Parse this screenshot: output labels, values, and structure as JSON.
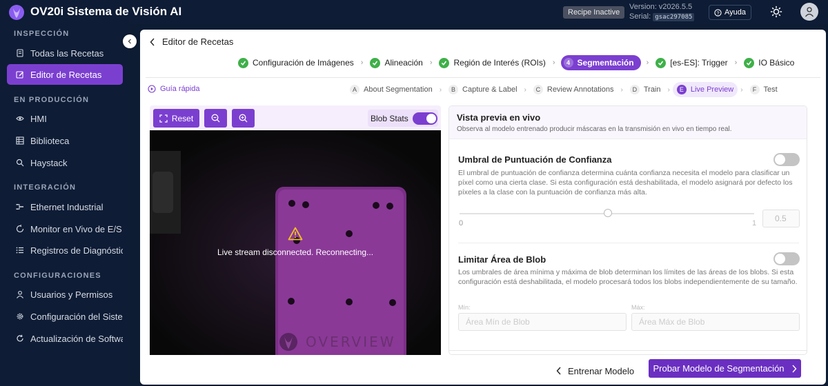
{
  "header": {
    "title": "OV20i Sistema de Visión AI",
    "recipe_badge": "Recipe Inactive",
    "version": "Version: v2026.5.5",
    "serial_label": "Serial:",
    "serial_value": "gsac297085",
    "help_label": "Ayuda"
  },
  "sidebar": {
    "sections": [
      {
        "title": "INSPECCIÓN",
        "items": [
          {
            "label": "Todas las Recetas",
            "icon": "document-icon"
          },
          {
            "label": "Editor de Recetas",
            "icon": "edit-icon",
            "active": true
          }
        ]
      },
      {
        "title": "EN PRODUCCIÓN",
        "items": [
          {
            "label": "HMI",
            "icon": "eye-icon"
          },
          {
            "label": "Biblioteca",
            "icon": "grid-icon"
          },
          {
            "label": "Haystack",
            "icon": "search-icon"
          }
        ]
      },
      {
        "title": "INTEGRACIÓN",
        "items": [
          {
            "label": "Ethernet Industrial",
            "icon": "network-icon"
          },
          {
            "label": "Monitor en Vivo de E/S",
            "icon": "monitor-icon"
          },
          {
            "label": "Registros de Diagnóstico",
            "icon": "log-icon"
          }
        ]
      },
      {
        "title": "CONFIGURACIONES",
        "items": [
          {
            "label": "Usuarios y Permisos",
            "icon": "user-icon"
          },
          {
            "label": "Configuración del Sistema",
            "icon": "gear-icon"
          },
          {
            "label": "Actualización de Software",
            "icon": "refresh-icon"
          }
        ]
      }
    ]
  },
  "page": {
    "back_label": "Editor de Recetas",
    "steps": [
      {
        "label": "Configuración de Imágenes",
        "state": "done"
      },
      {
        "label": "Alineación",
        "state": "done"
      },
      {
        "label": "Región de Interés (ROIs)",
        "state": "done"
      },
      {
        "label": "Segmentación",
        "state": "current",
        "number": "4"
      },
      {
        "label": "[es-ES]: Trigger",
        "state": "done"
      },
      {
        "label": "IO Básico",
        "state": "done"
      }
    ],
    "quick_guide": "Guía rápida",
    "substeps": [
      {
        "letter": "A",
        "label": "About Segmentation"
      },
      {
        "letter": "B",
        "label": "Capture & Label"
      },
      {
        "letter": "C",
        "label": "Review Annotations"
      },
      {
        "letter": "D",
        "label": "Train"
      },
      {
        "letter": "E",
        "label": "Live Preview",
        "current": true
      },
      {
        "letter": "F",
        "label": "Test"
      }
    ]
  },
  "viewer": {
    "reset_label": "Reset",
    "blob_stats_label": "Blob Stats",
    "blob_stats_on": true,
    "stream_message": "Live stream disconnected. Reconnecting...",
    "watermark": "OVERVIEW"
  },
  "panel": {
    "title": "Vista previa en vivo",
    "subtitle": "Observa al modelo entrenado producir máscaras en la transmisión en vivo en tiempo real.",
    "confidence": {
      "title": "Umbral de Puntuación de Confianza",
      "description": "El umbral de puntuación de confianza determina cuánta confianza necesita el modelo para clasificar un píxel como una cierta clase. Si esta configuración está deshabilitada, el modelo asignará por defecto los píxeles a la clase con la puntuación de confianza más alta.",
      "enabled": false,
      "min": "0",
      "max": "1",
      "value": "0.5",
      "slider_fraction": 0.5
    },
    "blob_area": {
      "title": "Limitar Área de Blob",
      "description": "Los umbrales de área mínima y máxima de blob determinan los límites de las áreas de los blobs. Si esta configuración está deshabilitada, el modelo procesará todos los blobs independientemente de su tamaño.",
      "enabled": false,
      "min_label": "Mín:",
      "max_label": "Máx:",
      "min_placeholder": "Área Mín de Blob",
      "max_placeholder": "Área Máx de Blob"
    }
  },
  "footer": {
    "back_label": "Entrenar Modelo",
    "primary_label": "Probar Modelo de Segmentación"
  },
  "colors": {
    "accent": "#7b3fd0",
    "sidebar_bg": "#0e1c35",
    "success": "#3fb049"
  }
}
